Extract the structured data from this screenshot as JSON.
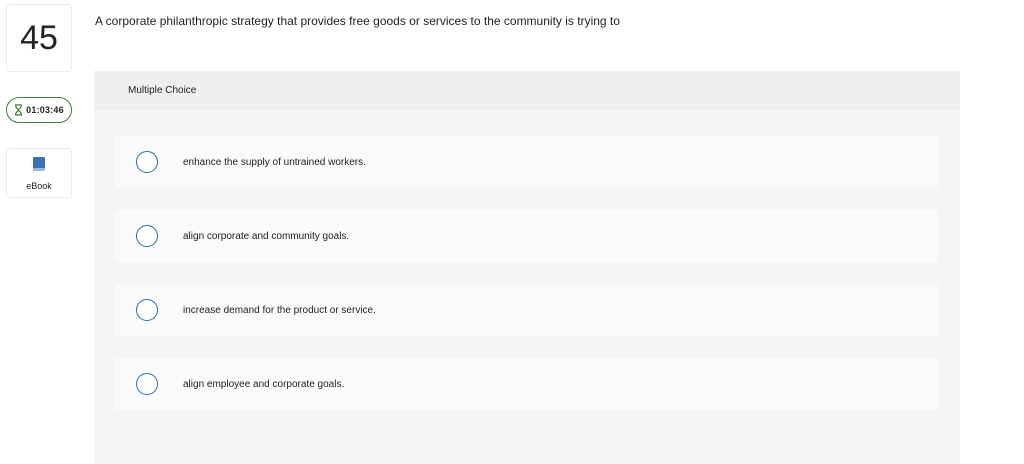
{
  "question": {
    "number": "45",
    "text": "A corporate philanthropic strategy that provides free goods or services to the community is trying to"
  },
  "timer": {
    "value": "01:03:46"
  },
  "ebook": {
    "label": "eBook"
  },
  "panel": {
    "header": "Multiple Choice",
    "choices": [
      {
        "label": "enhance the supply of untrained workers."
      },
      {
        "label": "align corporate and community goals."
      },
      {
        "label": "increase demand for the product or service."
      },
      {
        "label": "align employee and corporate goals."
      }
    ]
  },
  "colors": {
    "radio_border": "#1f6fb2",
    "timer_border": "#3f7c3f",
    "ebook_icon": "#3d6fb6",
    "panel_bg": "#f5f5f5"
  },
  "icons": {
    "timer": "hourglass-icon",
    "ebook": "book-icon"
  }
}
